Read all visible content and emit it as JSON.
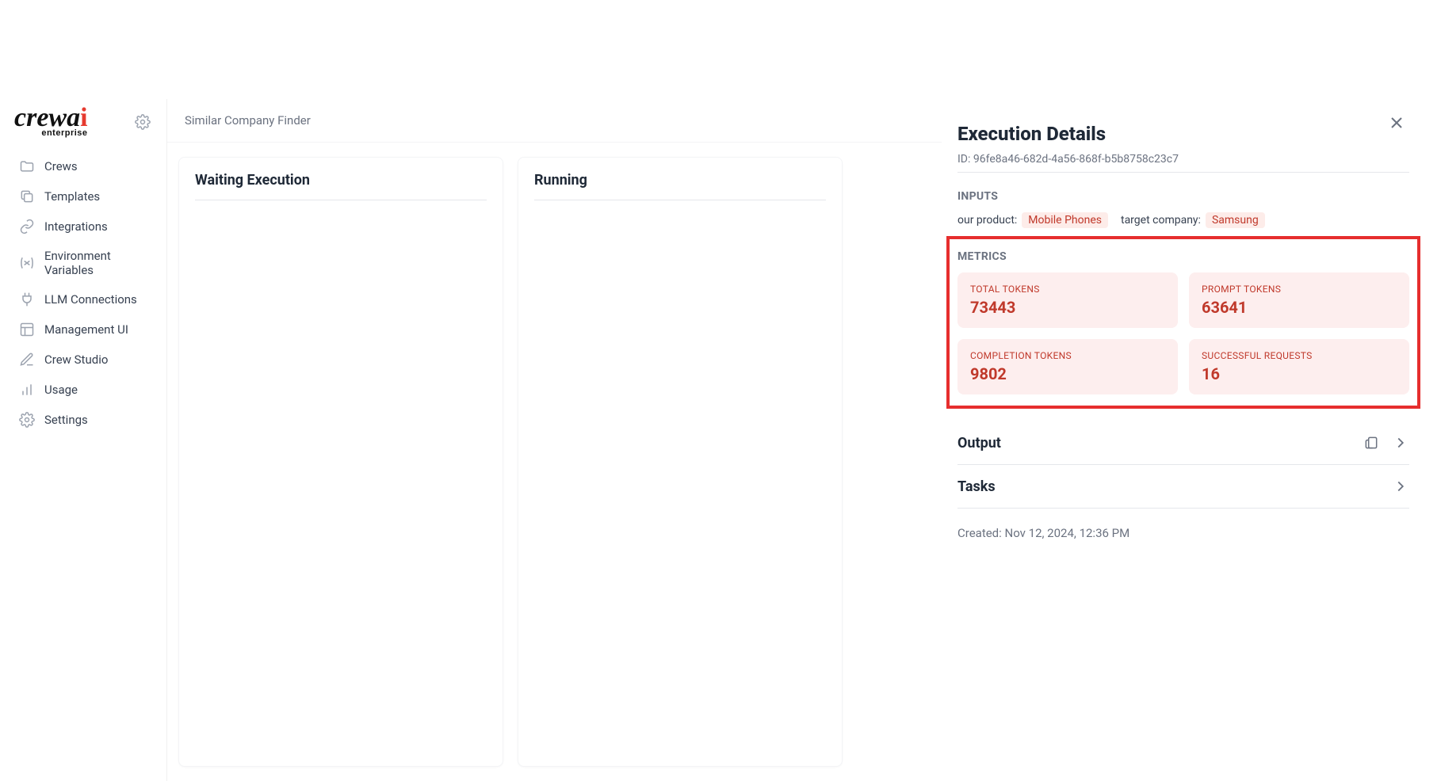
{
  "sidebar": {
    "items": [
      {
        "label": "Crews"
      },
      {
        "label": "Templates"
      },
      {
        "label": "Integrations"
      },
      {
        "label": "Environment Variables"
      },
      {
        "label": "LLM Connections"
      },
      {
        "label": "Management UI"
      },
      {
        "label": "Crew Studio"
      },
      {
        "label": "Usage"
      },
      {
        "label": "Settings"
      }
    ]
  },
  "header": {
    "breadcrumb": "Similar Company Finder"
  },
  "columns": {
    "waiting": {
      "title": "Waiting Execution"
    },
    "running": {
      "title": "Running"
    }
  },
  "details": {
    "title": "Execution Details",
    "id_label": "ID:",
    "id_value": "96fe8a46-682d-4a56-868f-b5b8758c23c7",
    "inputs_label": "INPUTS",
    "inputs": [
      {
        "key": "our product:",
        "value": "Mobile Phones"
      },
      {
        "key": "target company:",
        "value": "Samsung"
      }
    ],
    "metrics_label": "METRICS",
    "metrics": [
      {
        "label": "TOTAL TOKENS",
        "value": "73443"
      },
      {
        "label": "PROMPT TOKENS",
        "value": "63641"
      },
      {
        "label": "COMPLETION TOKENS",
        "value": "9802"
      },
      {
        "label": "SUCCESSFUL REQUESTS",
        "value": "16"
      }
    ],
    "output_label": "Output",
    "tasks_label": "Tasks",
    "created_label": "Created:",
    "created_value": "Nov 12, 2024, 12:36 PM"
  }
}
